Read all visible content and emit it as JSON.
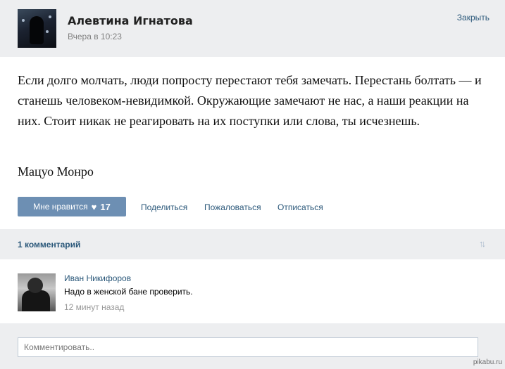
{
  "post": {
    "author": "Алевтина Игнатова",
    "time": "Вчера в 10:23",
    "close_label": "Закрыть",
    "text": "Если долго молчать, люди попросту перестают тебя замечать. Перестань болтать — и станешь человеком-невидимкой. Окружающие замечают не нас, а наши реакции на них. Стоит никак не реагировать на их поступки или слова, ты исчезнешь.",
    "quote_author": "Мацуо Монро",
    "like_label": "Мне нравится",
    "like_count": "17",
    "share_label": "Поделиться",
    "report_label": "Пожаловаться",
    "unsubscribe_label": "Отписаться"
  },
  "comments_section": {
    "count_label": "1 комментарий",
    "sort_icon": "sort-arrows-icon"
  },
  "comments": [
    {
      "author": "Иван Никифоров",
      "text": "Надо в женской бане проверить.",
      "time": "12 минут назад"
    }
  ],
  "comment_form": {
    "placeholder": "Комментировать..",
    "value": ""
  },
  "watermark": "pikabu.ru",
  "colors": {
    "accent": "#6d8fb3",
    "link": "#2b587a",
    "panel_bg": "#edeef0"
  }
}
